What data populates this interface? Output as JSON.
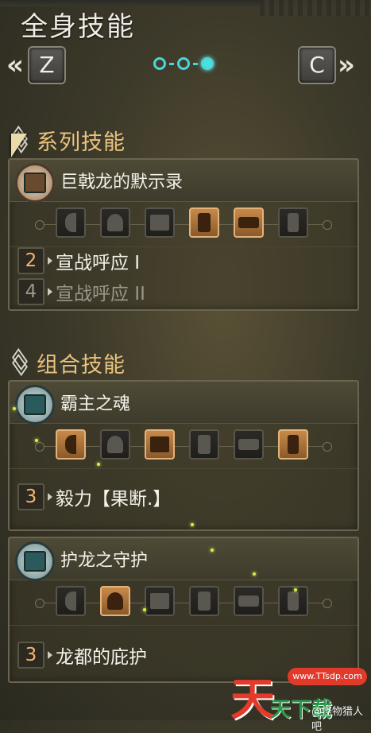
{
  "header": {
    "title": "全身技能",
    "left_arrow": "«",
    "right_arrow": "»",
    "left_key": "Z",
    "right_key": "C",
    "page_indicator": {
      "total": 3,
      "active": 3
    }
  },
  "series_section": {
    "title": "系列技能",
    "panels": [
      {
        "name": "巨戟龙的默示录",
        "badge_color": "#9a7a5a",
        "slots": [
          {
            "icon": "claw-icon",
            "on": false
          },
          {
            "icon": "helm-icon",
            "on": false
          },
          {
            "icon": "chest-icon",
            "on": false
          },
          {
            "icon": "arm-icon",
            "on": true
          },
          {
            "icon": "waist-icon",
            "on": true
          },
          {
            "icon": "leg-icon",
            "on": false
          }
        ],
        "skills": [
          {
            "level": "2",
            "text": "宣战呼应 I",
            "active": true
          },
          {
            "level": "4",
            "text": "宣战呼应 II",
            "active": false
          }
        ]
      }
    ]
  },
  "combo_section": {
    "title": "组合技能",
    "panels": [
      {
        "name": "霸主之魂",
        "badge_color": "#6d8a8a",
        "slots": [
          {
            "icon": "claw-icon",
            "on": true
          },
          {
            "icon": "helm-icon",
            "on": false
          },
          {
            "icon": "chest-icon",
            "on": true
          },
          {
            "icon": "arm-icon",
            "on": false
          },
          {
            "icon": "waist-icon",
            "on": false
          },
          {
            "icon": "leg-icon",
            "on": true
          }
        ],
        "skills": [
          {
            "level": "3",
            "text": "毅力【果断.】",
            "active": true
          }
        ]
      },
      {
        "name": "护龙之守护",
        "badge_color": "#6d8a8a",
        "slots": [
          {
            "icon": "claw-icon",
            "on": false
          },
          {
            "icon": "helm-icon",
            "on": true
          },
          {
            "icon": "chest-icon",
            "on": false
          },
          {
            "icon": "arm-icon",
            "on": false
          },
          {
            "icon": "waist-icon",
            "on": false
          },
          {
            "icon": "leg-icon",
            "on": false
          }
        ],
        "skills": [
          {
            "level": "3",
            "text": "龙都的庇护",
            "active": true
          }
        ]
      }
    ]
  },
  "watermark": {
    "big": "天",
    "pill": "www.TTsdp.com",
    "sub": "天下载",
    "credit": "@怪物猎人吧"
  },
  "colors": {
    "accent_cyan": "#4ad5d8",
    "section_title": "#e9c27e",
    "active_level": "#f4b272",
    "slot_on": "#c88a4a"
  }
}
